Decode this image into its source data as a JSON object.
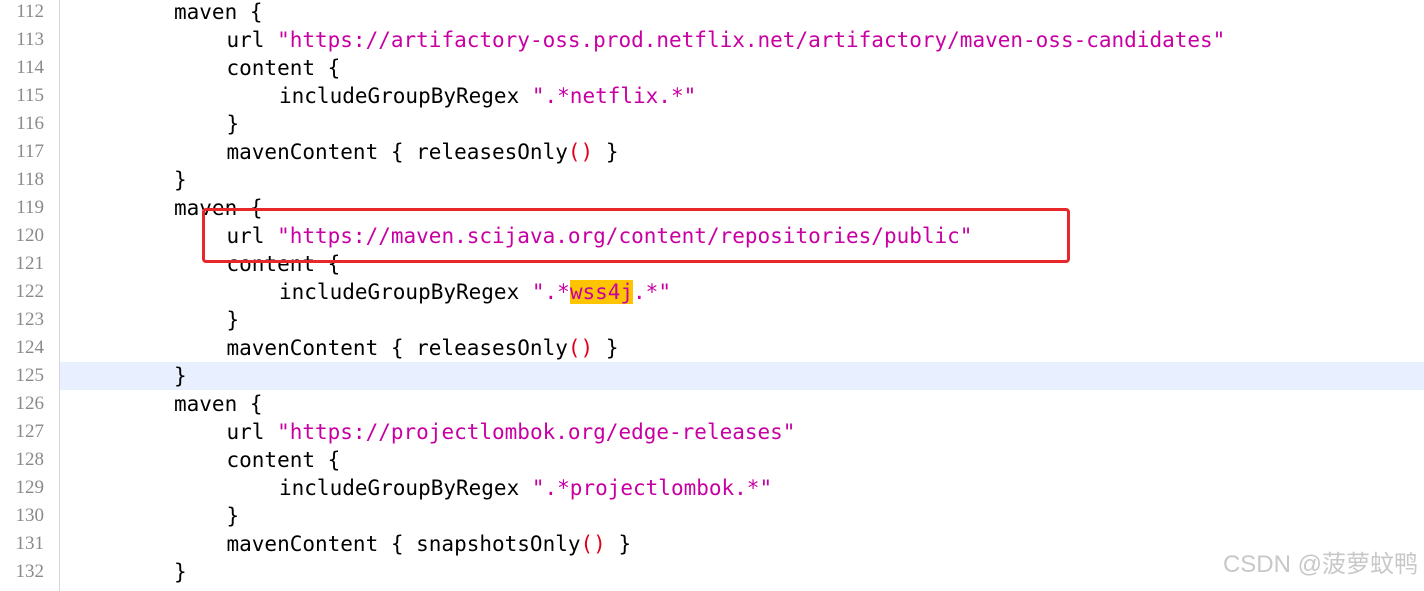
{
  "lines": [
    {
      "num": "112",
      "indent": 0,
      "parts": [
        [
          "maven {",
          "plain"
        ]
      ]
    },
    {
      "num": "113",
      "indent": 1,
      "parts": [
        [
          "url ",
          "plain"
        ],
        [
          "\"https://artifactory-oss.prod.netflix.net/artifactory/maven-oss-candidates\"",
          "str"
        ]
      ]
    },
    {
      "num": "114",
      "indent": 1,
      "parts": [
        [
          "content {",
          "plain"
        ]
      ]
    },
    {
      "num": "115",
      "indent": 2,
      "parts": [
        [
          "includeGroupByRegex ",
          "plain"
        ],
        [
          "\".*netflix.*\"",
          "str"
        ]
      ]
    },
    {
      "num": "116",
      "indent": 1,
      "parts": [
        [
          "}",
          "plain"
        ]
      ]
    },
    {
      "num": "117",
      "indent": 1,
      "parts": [
        [
          "mavenContent { releasesOnly",
          "plain"
        ],
        [
          "()",
          "paren"
        ],
        [
          " }",
          "plain"
        ]
      ]
    },
    {
      "num": "118",
      "indent": 0,
      "parts": [
        [
          "}",
          "plain"
        ]
      ]
    },
    {
      "num": "119",
      "indent": 0,
      "parts": [
        [
          "maven {",
          "plain"
        ]
      ]
    },
    {
      "num": "120",
      "indent": 1,
      "parts": [
        [
          "url ",
          "plain"
        ],
        [
          "\"https://maven.scijava.org/content/repositories/public\"",
          "str"
        ]
      ]
    },
    {
      "num": "121",
      "indent": 1,
      "parts": [
        [
          "content {",
          "plain"
        ]
      ]
    },
    {
      "num": "122",
      "indent": 2,
      "parts": [
        [
          "includeGroupByRegex ",
          "plain"
        ],
        [
          "\".*",
          "str"
        ],
        [
          "wss4j",
          "hl"
        ],
        [
          ".*\"",
          "str"
        ]
      ]
    },
    {
      "num": "123",
      "indent": 1,
      "parts": [
        [
          "}",
          "plain"
        ]
      ]
    },
    {
      "num": "124",
      "indent": 1,
      "parts": [
        [
          "mavenContent { releasesOnly",
          "plain"
        ],
        [
          "()",
          "paren"
        ],
        [
          " }",
          "plain"
        ]
      ]
    },
    {
      "num": "125",
      "indent": 0,
      "current": true,
      "parts": [
        [
          "}",
          "plain"
        ]
      ]
    },
    {
      "num": "126",
      "indent": 0,
      "parts": [
        [
          "maven {",
          "plain"
        ]
      ]
    },
    {
      "num": "127",
      "indent": 1,
      "parts": [
        [
          "url ",
          "plain"
        ],
        [
          "\"https://projectlombok.org/edge-releases\"",
          "str"
        ]
      ]
    },
    {
      "num": "128",
      "indent": 1,
      "parts": [
        [
          "content {",
          "plain"
        ]
      ]
    },
    {
      "num": "129",
      "indent": 2,
      "parts": [
        [
          "includeGroupByRegex ",
          "plain"
        ],
        [
          "\".*projectlombok.*\"",
          "str"
        ]
      ]
    },
    {
      "num": "130",
      "indent": 1,
      "parts": [
        [
          "}",
          "plain"
        ]
      ]
    },
    {
      "num": "131",
      "indent": 1,
      "parts": [
        [
          "mavenContent { snapshotsOnly",
          "plain"
        ],
        [
          "()",
          "paren"
        ],
        [
          " }",
          "plain"
        ]
      ]
    },
    {
      "num": "132",
      "indent": 0,
      "parts": [
        [
          "}",
          "plain"
        ]
      ]
    }
  ],
  "watermark": "CSDN @菠萝蚊鸭",
  "colors": {
    "string": "#c800a4",
    "paren": "#e0001a",
    "highlight": "#ffc400",
    "callout": "#e8272b",
    "current_line": "#e8f0ff"
  }
}
